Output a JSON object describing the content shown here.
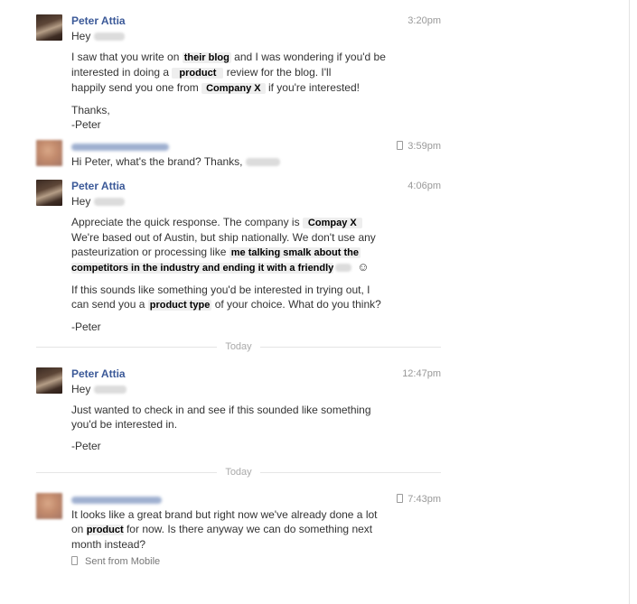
{
  "messages": [
    {
      "sender": "Peter Attia",
      "time": "3:20pm",
      "greeting": "Hey",
      "para1": [
        "I saw that you write on ",
        "their blog",
        " and I was wondering if you'd be",
        "interested in doing a ",
        "product",
        " review for the blog. I'll",
        "happily send you one from ",
        "Company X",
        " if you're interested!"
      ],
      "thanks": "Thanks,",
      "signoff": "-Peter"
    },
    {
      "time": "3:59pm",
      "text": "Hi Peter, what's the brand? Thanks,"
    },
    {
      "sender": "Peter Attia",
      "time": "4:06pm",
      "greeting": "Hey",
      "para1": [
        "Appreciate the quick response. The company is ",
        "Compay X",
        "We're based out of Austin, but ship nationally. We don't use any",
        "pasteurization or processing like ",
        "me talking smalk about the",
        "competitors in the industry and ending it with a friendly",
        "☺"
      ],
      "para2": [
        "If this sounds like something you'd be interested in trying out, I",
        "can send you a ",
        "product type",
        " of your choice. What do you think?"
      ],
      "signoff": "-Peter"
    },
    {
      "sender": "Peter Attia",
      "time": "12:47pm",
      "greeting": "Hey",
      "para1": [
        "Just wanted to check in and see if this sounded like something",
        "you'd be interested in."
      ],
      "signoff": "-Peter"
    },
    {
      "time": "7:43pm",
      "para1": [
        "It looks like a great brand but right now we've already done a lot",
        "on ",
        "product",
        " for now. Is there anyway we can do something next",
        "month instead?"
      ],
      "sent_from": "Sent from Mobile"
    }
  ],
  "dividers": [
    "Today",
    "Today"
  ]
}
